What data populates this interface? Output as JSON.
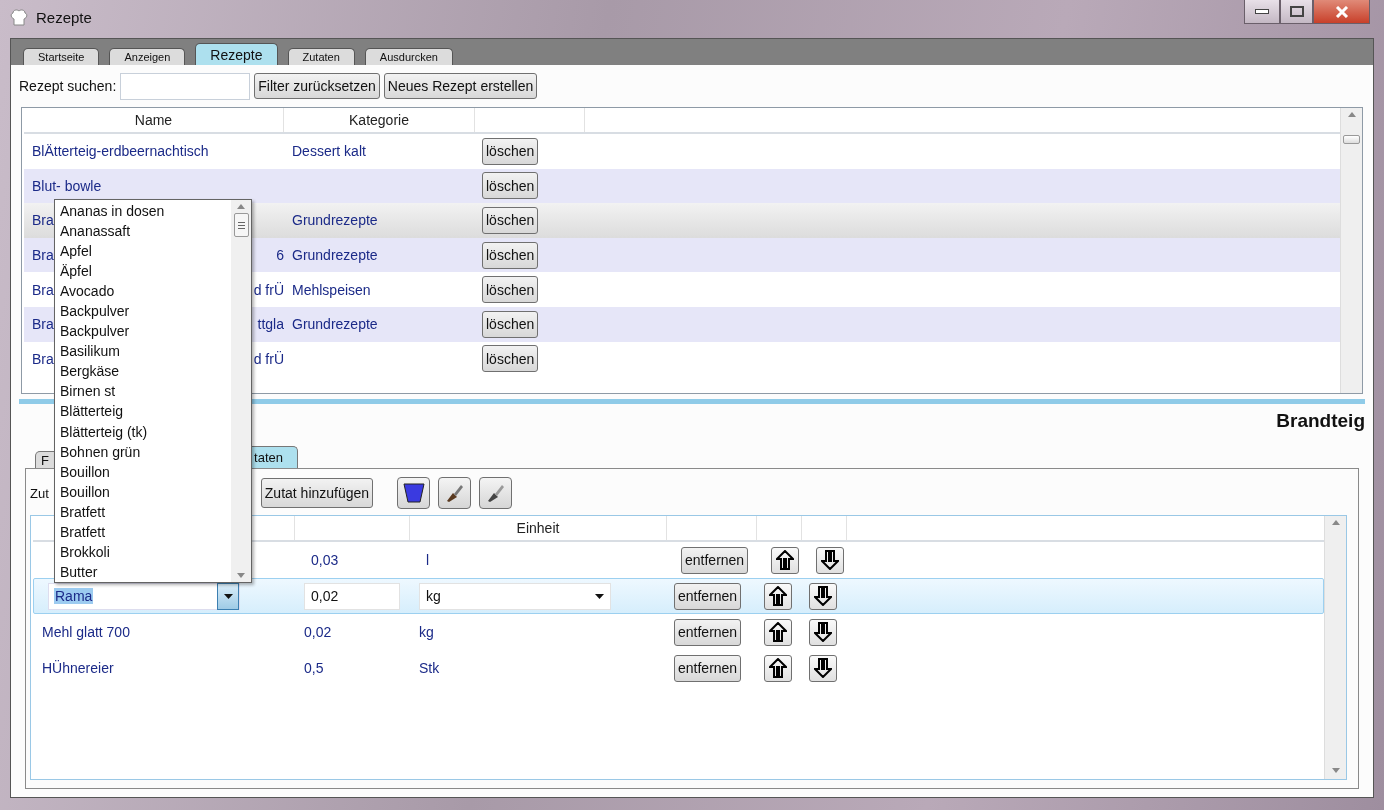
{
  "window": {
    "title": "Rezepte"
  },
  "tabs": [
    {
      "label": "Startseite",
      "selected": false
    },
    {
      "label": "Anzeigen",
      "selected": false
    },
    {
      "label": "Rezepte",
      "selected": true
    },
    {
      "label": "Zutaten",
      "selected": false
    },
    {
      "label": "Ausdurcken",
      "selected": false
    }
  ],
  "search": {
    "label": "Rezept suchen:"
  },
  "buttons": [
    "Filter zurücksetzen",
    "Neues Rezept erstellen"
  ],
  "recipe_table": {
    "columns": [
      "Name",
      "Kategorie"
    ],
    "rows": [
      {
        "name": "BlÄtterteig-erdbeernachtisch",
        "name_tail": "",
        "category": "Dessert kalt",
        "action": "löschen",
        "selected": false
      },
      {
        "name": "Blut- bowle",
        "name_tail": "",
        "category": "",
        "action": "löschen",
        "selected": false
      },
      {
        "name": "Bra",
        "name_tail": "",
        "category": "Grundrezepte",
        "action": "löschen",
        "selected": true
      },
      {
        "name": "Bra",
        "name_tail": "6",
        "category": "Grundrezepte",
        "action": "löschen",
        "selected": false
      },
      {
        "name": "Bra",
        "name_tail": "d frÜ",
        "category": "Mehlspeisen",
        "action": "löschen",
        "selected": false
      },
      {
        "name": "Bra",
        "name_tail": "ttgla",
        "category": "Grundrezepte",
        "action": "löschen",
        "selected": false
      },
      {
        "name": "Bra",
        "name_tail": "d frÜ",
        "category": "",
        "action": "löschen",
        "selected": false
      }
    ]
  },
  "detail": {
    "title": "Brandteig",
    "tabs": [
      {
        "label": "F",
        "selected": false
      },
      {
        "label": "taten",
        "selected": true
      }
    ],
    "toolbar_label": "Zut",
    "add_button": "Zutat hinzufügen",
    "ingredients": {
      "columns": [
        "",
        "",
        "Einheit"
      ],
      "rows": [
        {
          "kind": "view",
          "selected": false,
          "amount": "0,03",
          "unit": "l",
          "remove": "entfernen"
        },
        {
          "kind": "edit",
          "selected": true,
          "name": "Rama",
          "amount": "0,02",
          "unit": "kg",
          "remove": "entfernen"
        },
        {
          "kind": "view",
          "selected": false,
          "name": "Mehl glatt 700",
          "amount": "0,02",
          "unit": "kg",
          "remove": "entfernen"
        },
        {
          "kind": "view",
          "selected": false,
          "name": "HÜhnereier",
          "amount": "0,5",
          "unit": "Stk",
          "remove": "entfernen"
        }
      ]
    }
  },
  "dropdown": {
    "items": [
      "Ananas in dosen",
      "Ananassaft",
      "Apfel",
      "Äpfel",
      "Avocado",
      "Backpulver",
      "Backpulver",
      "Basilikum",
      "Bergkäse",
      "Birnen  st",
      "Blätterteig",
      "Blätterteig (tk)",
      "Bohnen grün",
      "Bouillon",
      "Bouillon",
      "Bratfett",
      "Bratfett",
      "Brokkoli",
      "Butter"
    ]
  }
}
